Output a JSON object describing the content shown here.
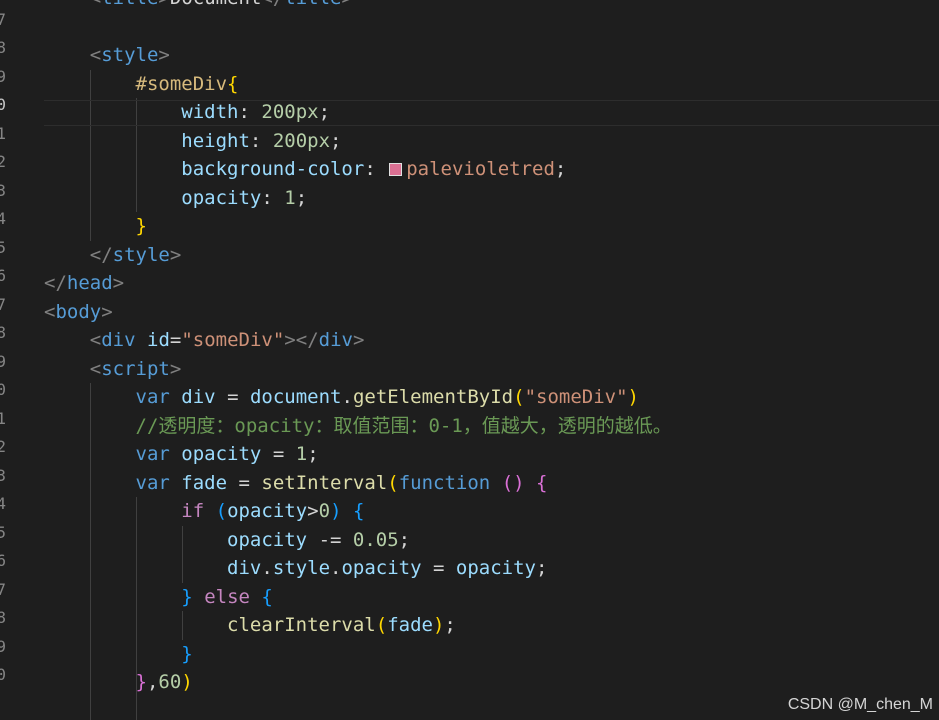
{
  "editor": {
    "language": "html",
    "lines": [
      {
        "text": "    <title>Document</title>",
        "partial": true
      },
      {
        "text": ""
      },
      {
        "text": "    <style>"
      },
      {
        "text": "        #someDiv{"
      },
      {
        "text": "            width: 200px;",
        "current": true
      },
      {
        "text": "            height: 200px;"
      },
      {
        "text": "            background-color: palevioletred;"
      },
      {
        "text": "            opacity: 1;"
      },
      {
        "text": "        }"
      },
      {
        "text": "    </style>"
      },
      {
        "text": "</head>"
      },
      {
        "text": "<body>"
      },
      {
        "text": "    <div id=\"someDiv\"></div>"
      },
      {
        "text": "    <script>"
      },
      {
        "text": "        var div = document.getElementById(\"someDiv\")"
      },
      {
        "text": "        //透明度：opacity：取值范围：0-1，值越大，透明的越低。"
      },
      {
        "text": "        var opacity = 1;"
      },
      {
        "text": "        var fade = setInterval(function () {"
      },
      {
        "text": "            if (opacity>0) {"
      },
      {
        "text": "                opacity -= 0.05;"
      },
      {
        "text": "                div.style.opacity = opacity;"
      },
      {
        "text": "            } else {"
      },
      {
        "text": "                clearInterval(fade);"
      },
      {
        "text": "            }"
      },
      {
        "text": "        },60)"
      }
    ],
    "gutter_digits": [
      "7",
      "8",
      "9",
      "0",
      "1",
      "2",
      "3",
      "4",
      "5",
      "6",
      "7",
      "8",
      "9",
      "0",
      "1",
      "2",
      "3",
      "4",
      "5",
      "6",
      "7",
      "8",
      "9",
      "0"
    ],
    "swatch_color": "#db7093"
  },
  "theme": {
    "background": "#1e1e1e",
    "foreground": "#d4d4d4"
  },
  "watermark": "CSDN @M_chen_M"
}
